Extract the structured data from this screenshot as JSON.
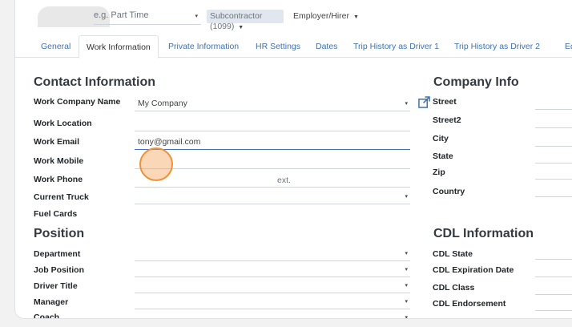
{
  "header": {
    "employment_type_placeholder": "e.g. Part Time",
    "contractor_type": "Subcontractor (1099)",
    "employer_role": "Employer/Hirer"
  },
  "tabs": [
    {
      "label": "General"
    },
    {
      "label": "Work Information"
    },
    {
      "label": "Private Information"
    },
    {
      "label": "HR Settings"
    },
    {
      "label": "Dates"
    },
    {
      "label": "Trip History as Driver 1"
    },
    {
      "label": "Trip History as Driver 2"
    },
    {
      "label": "Eq"
    }
  ],
  "contact": {
    "title": "Contact Information",
    "work_company_label": "Work Company Name",
    "work_company_value": "My Company",
    "work_location_label": "Work Location",
    "work_email_label": "Work Email",
    "work_email_value": "tony@gmail.com",
    "work_mobile_label": "Work Mobile",
    "work_phone_label": "Work Phone",
    "ext_label": "ext.",
    "current_truck_label": "Current Truck",
    "fuel_cards_label": "Fuel Cards"
  },
  "position": {
    "title": "Position",
    "department_label": "Department",
    "job_position_label": "Job Position",
    "driver_title_label": "Driver Title",
    "manager_label": "Manager",
    "coach_label": "Coach"
  },
  "company_info": {
    "title": "Company Info",
    "street_label": "Street",
    "street2_label": "Street2",
    "city_label": "City",
    "state_label": "State",
    "zip_label": "Zip",
    "country_label": "Country"
  },
  "cdl": {
    "title": "CDL Information",
    "state_label": "CDL State",
    "expiration_label": "CDL Expiration Date",
    "class_label": "CDL Class",
    "endorsement_label": "CDL Endorsement"
  },
  "colors": {
    "link_blue": "#3d72b4",
    "cursor_orange": "#f0913a"
  }
}
